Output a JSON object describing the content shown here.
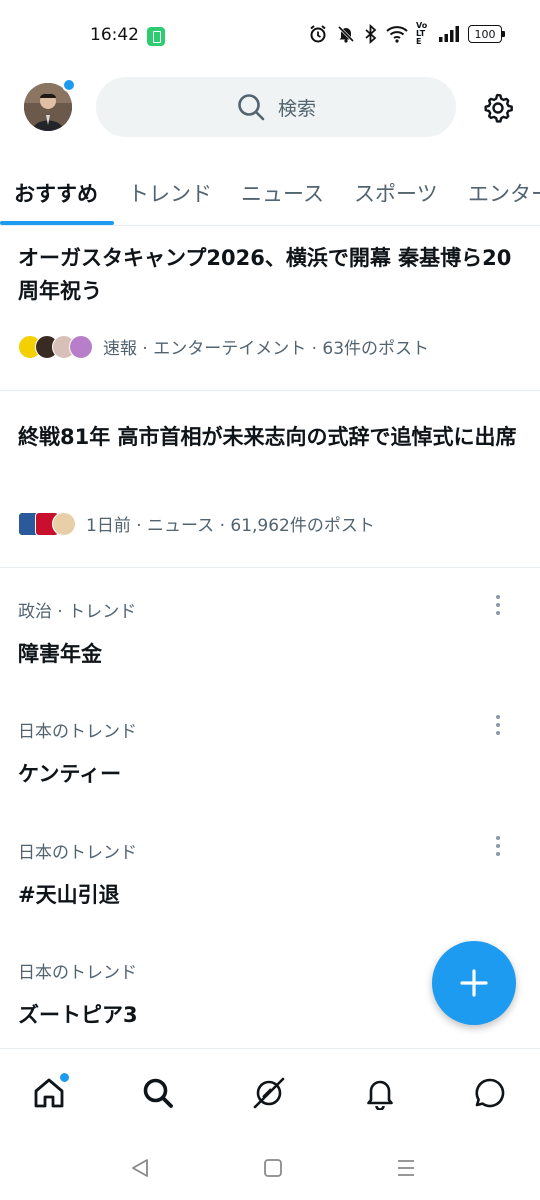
{
  "status_bar": {
    "time": "16:42",
    "battery": "100",
    "network_label": "Vo LTE",
    "icons": [
      "battery-saver-icon",
      "alarm-icon",
      "mute-icon",
      "bluetooth-icon",
      "wifi-icon",
      "volte-icon",
      "signal-icon",
      "battery-icon"
    ]
  },
  "header": {
    "search_placeholder": "検索",
    "avatar_notification": true
  },
  "tabs": [
    {
      "label": "おすすめ",
      "active": true
    },
    {
      "label": "トレンド",
      "active": false
    },
    {
      "label": "ニュース",
      "active": false
    },
    {
      "label": "スポーツ",
      "active": false
    },
    {
      "label": "エンター",
      "active": false
    }
  ],
  "news": [
    {
      "title": "オーガスタキャンプ2026、横浜で開幕 秦基博ら20周年祝う",
      "meta": "速報 · エンターテイメント · 63件のポスト"
    },
    {
      "title": "終戦81年 高市首相が未来志向の式辞で追悼式に出席",
      "meta": "1日前 · ニュース · 61,962件のポスト"
    }
  ],
  "trends": [
    {
      "category": "政治 · トレンド",
      "name": "障害年金",
      "has_more": true
    },
    {
      "category": "日本のトレンド",
      "name": "ケンティー",
      "has_more": true
    },
    {
      "category": "日本のトレンド",
      "name": "#天山引退",
      "has_more": true
    },
    {
      "category": "日本のトレンド",
      "name": "ズートピア3",
      "has_more": false
    }
  ],
  "fab": {
    "icon": "plus-icon"
  },
  "bottom_nav": [
    {
      "name": "home",
      "icon": "home-icon",
      "active": true,
      "notification": true
    },
    {
      "name": "explore",
      "icon": "search-icon",
      "active": false
    },
    {
      "name": "grok",
      "icon": "grok-icon",
      "active": false
    },
    {
      "name": "notifications",
      "icon": "bell-icon",
      "active": false
    },
    {
      "name": "messages",
      "icon": "message-icon",
      "active": false
    }
  ],
  "colors": {
    "accent": "#1d9bf0",
    "text_primary": "#0f1419",
    "text_secondary": "#536471",
    "divider": "#e6ecf0",
    "search_bg": "#eff3f4"
  }
}
